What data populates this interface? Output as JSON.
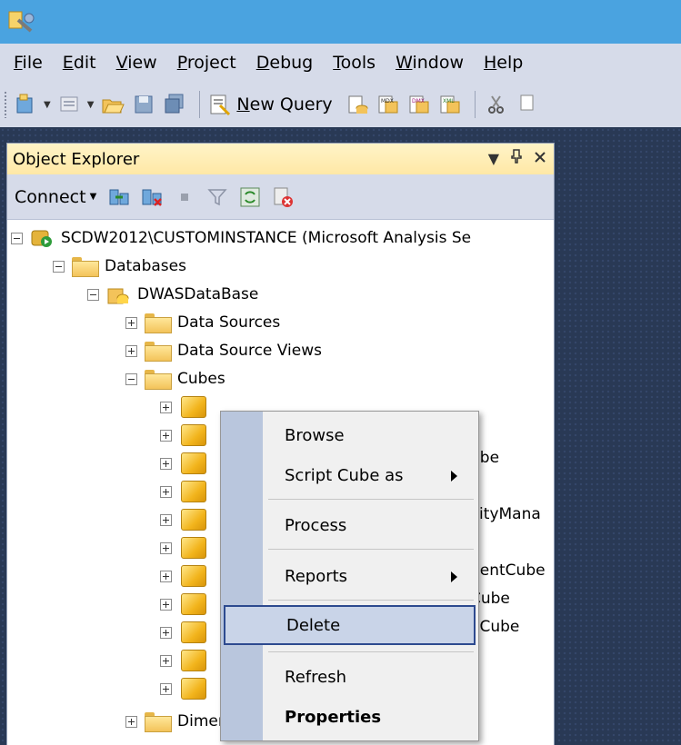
{
  "menubar": {
    "items": [
      {
        "pre": "",
        "mn": "F",
        "post": "ile"
      },
      {
        "pre": "",
        "mn": "E",
        "post": "dit"
      },
      {
        "pre": "",
        "mn": "V",
        "post": "iew"
      },
      {
        "pre": "",
        "mn": "P",
        "post": "roject"
      },
      {
        "pre": "",
        "mn": "D",
        "post": "ebug"
      },
      {
        "pre": "",
        "mn": "T",
        "post": "ools"
      },
      {
        "pre": "",
        "mn": "W",
        "post": "indow"
      },
      {
        "pre": "",
        "mn": "H",
        "post": "elp"
      }
    ]
  },
  "toolbar": {
    "new_query_mn": "N",
    "new_query_rest": "ew Query",
    "icons": [
      "new-project-icon",
      "add-item-icon",
      "open-file-icon",
      "save-icon",
      "save-all-icon",
      "new-query-icon",
      "database-engine-query-icon",
      "mdx-query-icon",
      "dmx-query-icon",
      "xmla-query-icon",
      "cut-icon",
      "copy-icon"
    ]
  },
  "object_explorer": {
    "title": "Object Explorer",
    "controls": [
      "▾",
      "ᵩ",
      "✕"
    ],
    "connect_label": "Connect",
    "tree": {
      "server": "SCDW2012\\CUSTOMINSTANCE (Microsoft Analysis Se",
      "databases": "Databases",
      "database": "DWASDataBase",
      "data_sources": "Data Sources",
      "data_source_views": "Data Source Views",
      "cubes": "Cubes",
      "dimensions": "Dimensions",
      "cube_label_fragments": [
        "ube",
        "vityMana",
        "e",
        "nentCube",
        "Cube",
        "eCube",
        "e"
      ]
    }
  },
  "context_menu": {
    "items": {
      "browse": "Browse",
      "script_cube_as": "Script Cube as",
      "process": "Process",
      "reports": "Reports",
      "delete": "Delete",
      "refresh": "Refresh",
      "properties": "Properties"
    }
  },
  "colors": {
    "titlebar": "#4aa3e0",
    "menubar": "#d6dbe9",
    "panel_header": "#ffe8a6",
    "workspace": "#293955",
    "menu_highlight_border": "#2d4a8f"
  }
}
